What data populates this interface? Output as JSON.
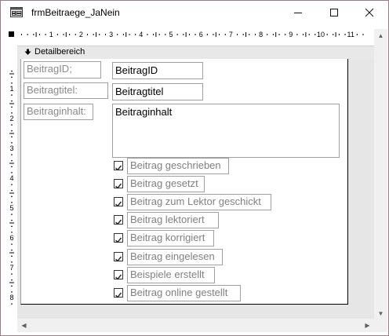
{
  "window": {
    "title": "frmBeitraege_JaNein",
    "icon": "form-icon",
    "controls": [
      "minimize-icon",
      "maximize-icon",
      "close-icon"
    ]
  },
  "ruler": {
    "horizontal_numbers": [
      "1",
      "2",
      "3",
      "4",
      "5",
      "6",
      "7",
      "8",
      "9",
      "10",
      "11"
    ],
    "vertical_numbers": [
      "1",
      "2",
      "3",
      "4",
      "5",
      "6",
      "7",
      "8"
    ]
  },
  "section": {
    "label": "Detailbereich",
    "icon": "chevron-down-icon"
  },
  "fields": [
    {
      "label": "BeitragID;",
      "value": "BeitragID"
    },
    {
      "label": "Beitragtitel:",
      "value": "Beitragtitel"
    },
    {
      "label": "Beitraginhalt:",
      "value": "Beitraginhalt"
    }
  ],
  "checkboxes": [
    {
      "label": "Beitrag geschrieben",
      "checked": true
    },
    {
      "label": "Beitrag gesetzt",
      "checked": true
    },
    {
      "label": "Beitrag zum Lektor geschickt",
      "checked": true
    },
    {
      "label": "Beitrag lektoriert",
      "checked": true
    },
    {
      "label": "Beitrag korrigiert",
      "checked": true
    },
    {
      "label": "Beitrag eingelesen",
      "checked": true
    },
    {
      "label": "Beispiele erstellt",
      "checked": true
    },
    {
      "label": "Beitrag online gestellt",
      "checked": true
    }
  ]
}
